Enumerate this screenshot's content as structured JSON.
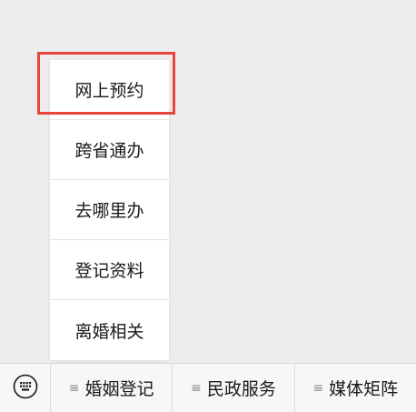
{
  "popup_menu": {
    "items": [
      {
        "label": "网上预约"
      },
      {
        "label": "跨省通办"
      },
      {
        "label": "去哪里办"
      },
      {
        "label": "登记资料"
      },
      {
        "label": "离婚相关"
      }
    ]
  },
  "highlight": {
    "color": "#e8453c"
  },
  "bottom_bar": {
    "keyboard_icon": "keyboard-icon",
    "tabs": [
      {
        "label": "婚姻登记",
        "icon": "menu-lines-icon"
      },
      {
        "label": "民政服务",
        "icon": "menu-lines-icon"
      },
      {
        "label": "媒体矩阵",
        "icon": "menu-lines-icon"
      }
    ]
  }
}
